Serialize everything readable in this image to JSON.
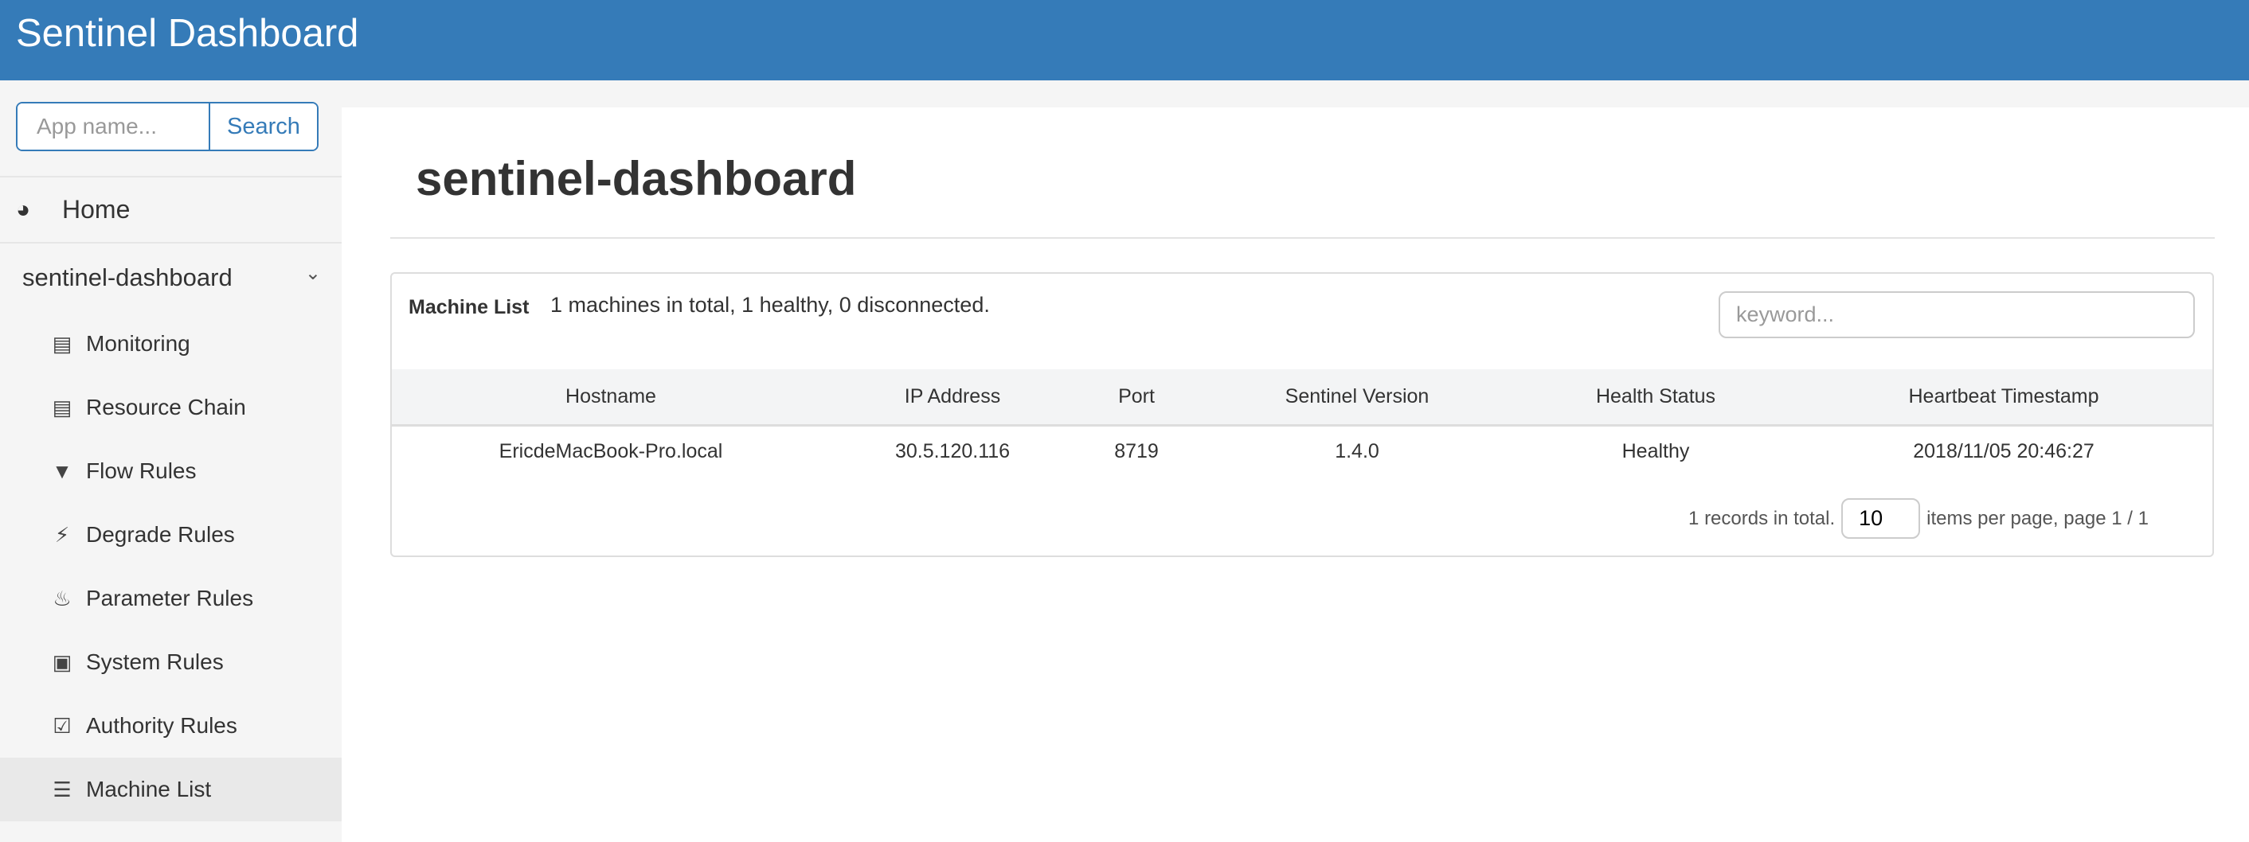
{
  "header": {
    "title": "Sentinel Dashboard"
  },
  "sidebar": {
    "search": {
      "placeholder": "App name...",
      "button": "Search"
    },
    "home": "Home",
    "app": "sentinel-dashboard",
    "items": [
      {
        "label": "Monitoring",
        "icon": "bar-chart-icon"
      },
      {
        "label": "Resource Chain",
        "icon": "list-alt-icon"
      },
      {
        "label": "Flow Rules",
        "icon": "filter-icon"
      },
      {
        "label": "Degrade Rules",
        "icon": "flash-icon"
      },
      {
        "label": "Parameter Rules",
        "icon": "fire-icon"
      },
      {
        "label": "System Rules",
        "icon": "briefcase-icon"
      },
      {
        "label": "Authority Rules",
        "icon": "check-icon"
      },
      {
        "label": "Machine List",
        "icon": "th-list-icon",
        "active": true
      }
    ]
  },
  "main": {
    "title": "sentinel-dashboard",
    "panel": {
      "title": "Machine List",
      "summary": "1 machines in total, 1 healthy, 0 disconnected.",
      "keyword_placeholder": "keyword...",
      "columns": [
        "Hostname",
        "IP Address",
        "Port",
        "Sentinel Version",
        "Health Status",
        "Heartbeat Timestamp"
      ],
      "rows": [
        [
          "EricdeMacBook-Pro.local",
          "30.5.120.116",
          "8719",
          "1.4.0",
          "Healthy",
          "2018/11/05 20:46:27"
        ]
      ],
      "pager": {
        "total": "1 records in total.",
        "page_size": "10",
        "suffix": "items per page, page 1 / 1"
      }
    }
  },
  "colors": {
    "brand": "#357bb8"
  }
}
